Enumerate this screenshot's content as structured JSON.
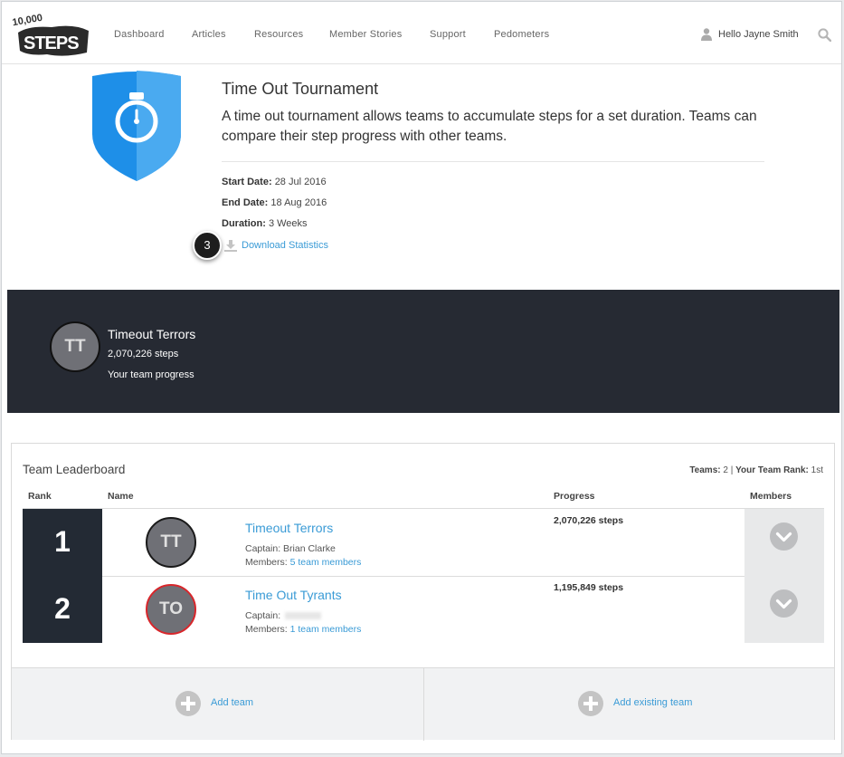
{
  "header": {
    "logo_text": "10,000 STEPS",
    "nav": [
      "Dashboard",
      "Articles",
      "Resources",
      "Member Stories",
      "Support",
      "Pedometers"
    ],
    "greeting": "Hello Jayne Smith"
  },
  "tournament": {
    "title": "Time Out Tournament",
    "description": "A time out tournament allows teams to accumulate steps for a set duration. Teams can compare their step progress with other teams.",
    "start_label": "Start Date:",
    "start_value": "28 Jul 2016",
    "end_label": "End Date:",
    "end_value": "18 Aug 2016",
    "duration_label": "Duration:",
    "duration_value": "3 Weeks",
    "download_label": "Download Statistics",
    "step_number": "3"
  },
  "my_team": {
    "initials": "TT",
    "name": "Timeout Terrors",
    "steps": "2,070,226 steps",
    "progress_label": "Your team progress"
  },
  "leaderboard": {
    "title": "Team Leaderboard",
    "teams_label": "Teams:",
    "teams_count": "2",
    "separator": "|",
    "rank_label": "Your Team Rank:",
    "rank_value": "1st",
    "columns": {
      "rank": "Rank",
      "name": "Name",
      "progress": "Progress",
      "members": "Members"
    },
    "rows": [
      {
        "rank": "1",
        "initials": "TT",
        "name": "Timeout Terrors",
        "captain_label": "Captain:",
        "captain": "Brian Clarke",
        "members_label": "Members:",
        "members": "5 team members",
        "progress": "2,070,226 steps",
        "avatar_border": "#1a1a1a"
      },
      {
        "rank": "2",
        "initials": "TO",
        "name": "Time Out Tyrants",
        "captain_label": "Captain:",
        "captain": "",
        "members_label": "Members:",
        "members": "1 team members",
        "progress": "1,195,849 steps",
        "avatar_border": "#d8262b"
      }
    ],
    "add_team": "Add team",
    "add_existing": "Add existing team"
  },
  "colors": {
    "link": "#3a9bd6",
    "dark_band": "#262a33",
    "rank_cell": "#232a34",
    "badge_blue": "#1e8fe8"
  }
}
